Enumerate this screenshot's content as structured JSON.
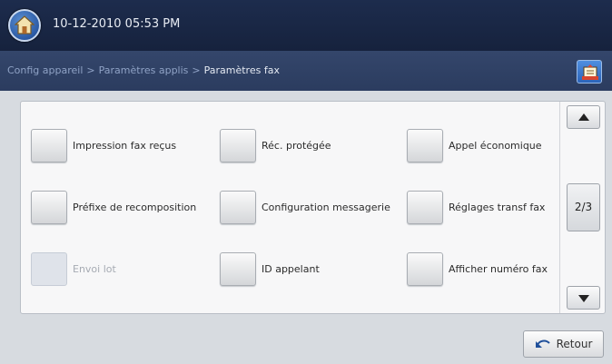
{
  "header": {
    "datetime": "10-12-2010 05:53 PM",
    "home_icon": "home-icon"
  },
  "breadcrumb": {
    "items": [
      "Config appareil",
      "Paramètres applis",
      "Paramètres fax"
    ],
    "separator": ">"
  },
  "toolbar": {
    "job_status_icon": "job-status-icon"
  },
  "options": [
    {
      "label": "Impression fax reçus",
      "enabled": true
    },
    {
      "label": "Réc. protégée",
      "enabled": true
    },
    {
      "label": "Appel économique",
      "enabled": true
    },
    {
      "label": "Préfixe de recomposition",
      "enabled": true
    },
    {
      "label": "Configuration messagerie",
      "enabled": true
    },
    {
      "label": "Réglages transf fax",
      "enabled": true
    },
    {
      "label": "Envoi lot",
      "enabled": false
    },
    {
      "label": "ID appelant",
      "enabled": true
    },
    {
      "label": "Afficher numéro fax",
      "enabled": true
    }
  ],
  "pager": {
    "page_label": "2/3"
  },
  "footer": {
    "back_label": "Retour"
  },
  "colors": {
    "topbar": "#1d2c4d",
    "crumbbar": "#2b3c5f",
    "panel": "#f7f7f8",
    "background": "#d7dbe0"
  }
}
